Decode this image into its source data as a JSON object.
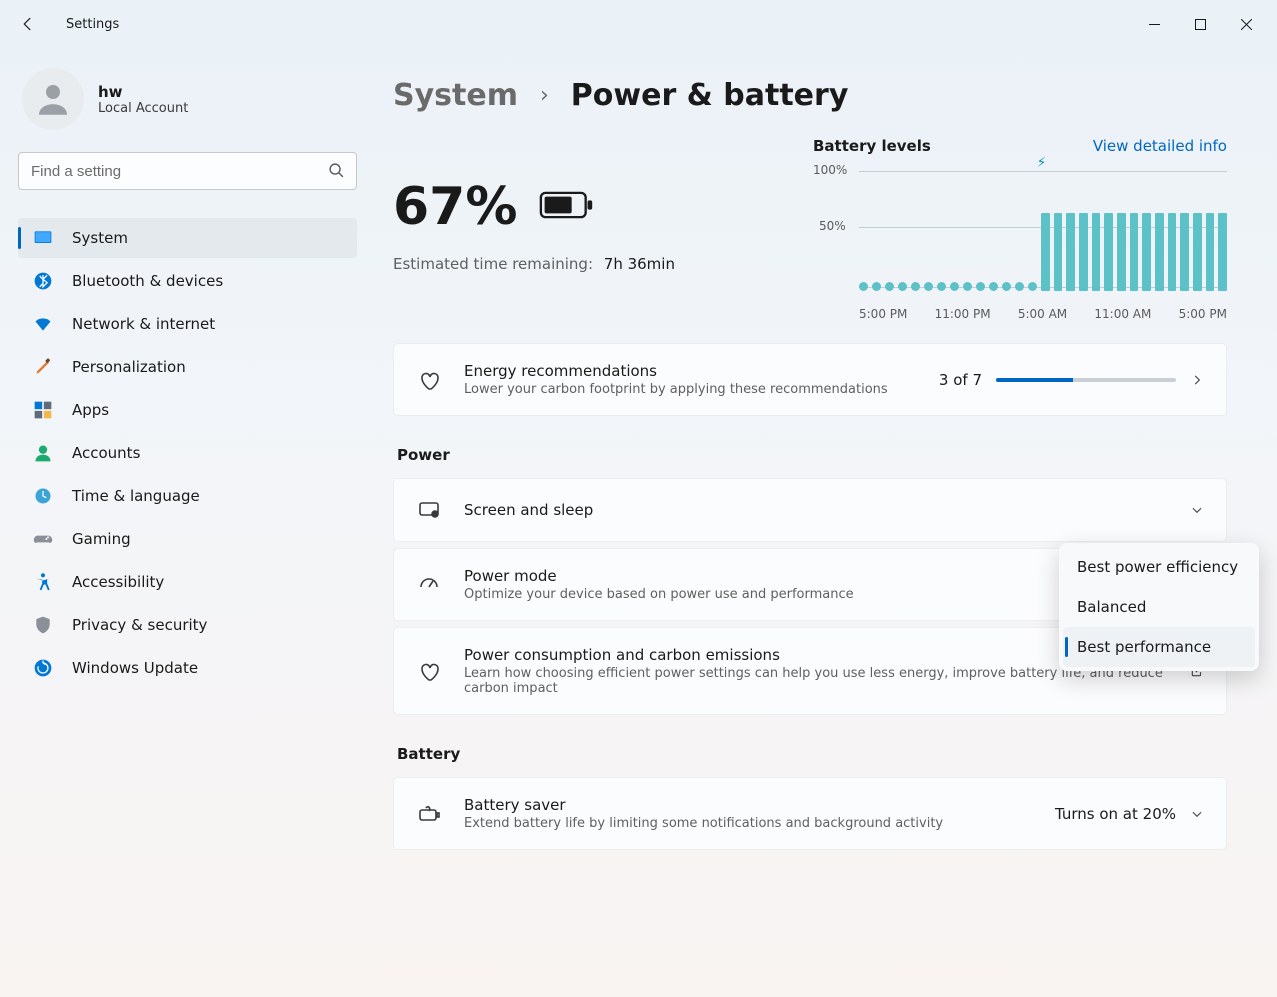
{
  "titlebar": {
    "app_name": "Settings"
  },
  "account": {
    "name": "hw",
    "subtitle": "Local Account"
  },
  "search": {
    "placeholder": "Find a setting"
  },
  "nav": {
    "items": [
      {
        "label": "System"
      },
      {
        "label": "Bluetooth & devices"
      },
      {
        "label": "Network & internet"
      },
      {
        "label": "Personalization"
      },
      {
        "label": "Apps"
      },
      {
        "label": "Accounts"
      },
      {
        "label": "Time & language"
      },
      {
        "label": "Gaming"
      },
      {
        "label": "Accessibility"
      },
      {
        "label": "Privacy & security"
      },
      {
        "label": "Windows Update"
      }
    ],
    "active_index": 0
  },
  "breadcrumb": {
    "root": "System",
    "current": "Power & battery"
  },
  "battery": {
    "percent": "67%",
    "est_label": "Estimated time remaining:",
    "est_value": "7h 36min",
    "levels_title": "Battery levels",
    "link": "View detailed info"
  },
  "chart_data": {
    "type": "bar",
    "title": "Battery levels",
    "ylabel": "%",
    "ylim": [
      0,
      100
    ],
    "y_ticks": [
      "100%",
      "50%"
    ],
    "x_ticks": [
      "5:00 PM",
      "11:00 PM",
      "5:00 AM",
      "11:00 AM",
      "5:00 PM"
    ],
    "charging_marker_hour_index": 14,
    "series": [
      {
        "name": "battery_level",
        "values": [
          6,
          6,
          6,
          6,
          6,
          6,
          6,
          6,
          6,
          6,
          6,
          6,
          6,
          6,
          67,
          67,
          67,
          67,
          67,
          67,
          67,
          67,
          67,
          67,
          67,
          67,
          67,
          67,
          67
        ],
        "colors": [
          "#5cc2c7"
        ]
      }
    ]
  },
  "energy": {
    "title": "Energy recommendations",
    "sub": "Lower your carbon footprint by applying these recommendations",
    "count": "3 of 7",
    "progress_pct": 43
  },
  "sections": {
    "power": "Power",
    "battery": "Battery"
  },
  "power_cards": {
    "screen": {
      "title": "Screen and sleep"
    },
    "mode": {
      "title": "Power mode",
      "sub": "Optimize your device based on power use and performance"
    },
    "carbon": {
      "title": "Power consumption and carbon emissions",
      "sub": "Learn how choosing efficient power settings can help you use less energy, improve battery life, and reduce carbon impact"
    }
  },
  "battery_cards": {
    "saver": {
      "title": "Battery saver",
      "sub": "Extend battery life by limiting some notifications and background activity",
      "value": "Turns on at 20%"
    }
  },
  "power_mode_popup": {
    "options": [
      "Best power efficiency",
      "Balanced",
      "Best performance"
    ],
    "selected_index": 2
  }
}
